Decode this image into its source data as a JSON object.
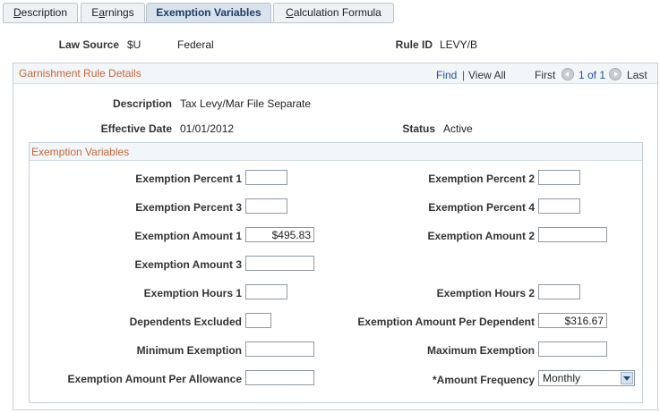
{
  "tabs": [
    {
      "label": "Description",
      "ukey": "D",
      "rest": "escription"
    },
    {
      "label": "Earnings",
      "pre": "E",
      "ukey": "a",
      "rest": "rnings"
    },
    {
      "label": "Exemption Variables"
    },
    {
      "label": "Calculation Formula",
      "ukey": "C",
      "rest": "alculation Formula"
    }
  ],
  "header": {
    "law_source_label": "Law Source",
    "law_source_code": "$U",
    "law_source_value": "Federal",
    "rule_id_label": "Rule ID",
    "rule_id_value": "LEVY/B"
  },
  "details": {
    "title": "Garnishment Rule Details",
    "find": "Find",
    "sep": "|",
    "view_all": "View All",
    "first": "First",
    "count": "1 of 1",
    "last": "Last",
    "description_label": "Description",
    "description_value": "Tax Levy/Mar File Separate",
    "effective_date_label": "Effective Date",
    "effective_date_value": "01/01/2012",
    "status_label": "Status",
    "status_value": "Active"
  },
  "exemption": {
    "title": "Exemption Variables",
    "pct1_label": "Exemption Percent 1",
    "pct1_value": "",
    "pct2_label": "Exemption Percent 2",
    "pct2_value": "",
    "pct3_label": "Exemption Percent 3",
    "pct3_value": "",
    "pct4_label": "Exemption Percent 4",
    "pct4_value": "",
    "amt1_label": "Exemption Amount 1",
    "amt1_value": "$495.83",
    "amt2_label": "Exemption Amount 2",
    "amt2_value": "",
    "amt3_label": "Exemption Amount 3",
    "amt3_value": "",
    "hrs1_label": "Exemption Hours 1",
    "hrs1_value": "",
    "hrs2_label": "Exemption Hours 2",
    "hrs2_value": "",
    "dep_excl_label": "Dependents Excluded",
    "dep_excl_value": "",
    "amt_per_dep_label": "Exemption Amount Per Dependent",
    "amt_per_dep_value": "$316.67",
    "min_label": "Minimum Exemption",
    "min_value": "",
    "max_label": "Maximum Exemption",
    "max_value": "",
    "amt_per_allow_label": "Exemption Amount Per Allowance",
    "amt_per_allow_value": "",
    "freq_label": "*Amount Frequency",
    "freq_value": "Monthly"
  }
}
